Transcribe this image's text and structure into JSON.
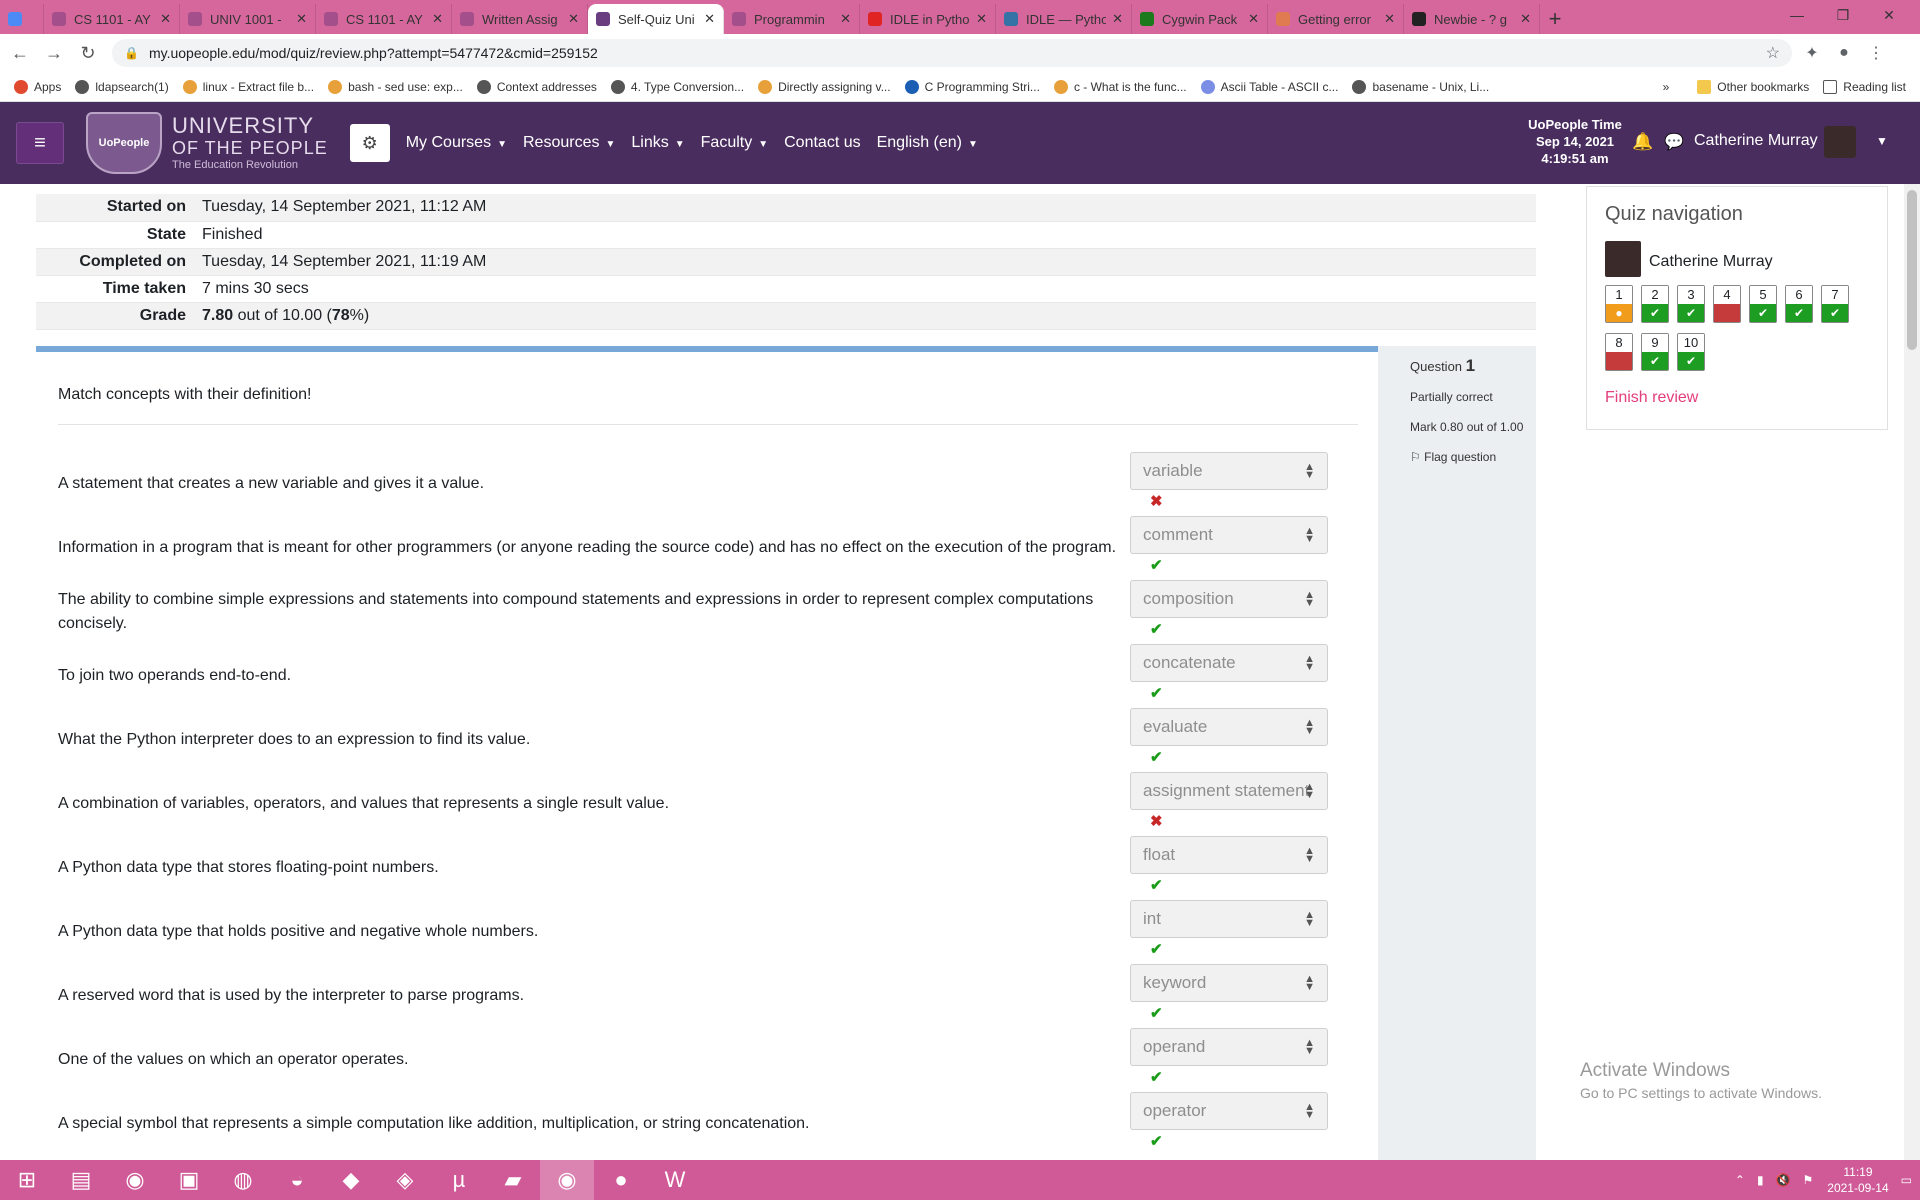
{
  "browser": {
    "tabs": [
      {
        "title": "",
        "color": "#4c8bf5"
      },
      {
        "title": "CS 1101 - AY",
        "color": "#a34f8c"
      },
      {
        "title": "UNIV 1001 -",
        "color": "#a34f8c"
      },
      {
        "title": "CS 1101 - AY",
        "color": "#a34f8c"
      },
      {
        "title": "Written Assig",
        "color": "#a34f8c"
      },
      {
        "title": "Self-Quiz Uni",
        "color": "#6a3d80",
        "active": true
      },
      {
        "title": "Programmin",
        "color": "#a34f8c"
      },
      {
        "title": "IDLE in Pytho",
        "color": "#e02424"
      },
      {
        "title": "IDLE — Pytho",
        "color": "#3572a5"
      },
      {
        "title": "Cygwin Pack",
        "color": "#1b7a1b"
      },
      {
        "title": "Getting error",
        "color": "#e07a50"
      },
      {
        "title": "Newbie - ? g",
        "color": "#222"
      }
    ],
    "url": "my.uopeople.edu/mod/quiz/review.php?attempt=5477472&cmid=259152",
    "bookmarks": [
      "Apps",
      "ldapsearch(1)",
      "linux - Extract file b...",
      "bash - sed use: exp...",
      "Context addresses",
      "4. Type Conversion...",
      "Directly assigning v...",
      "C Programming Stri...",
      "c - What is the func...",
      "Ascii Table - ASCII c...",
      "basename - Unix, Li..."
    ],
    "other_bookmarks": "Other bookmarks",
    "reading_list": "Reading list",
    "more": "»"
  },
  "header": {
    "logo": {
      "badge": "UoPeople",
      "line1": "UNIVERSITY",
      "line2": "OF THE PEOPLE",
      "tagline": "The Education Revolution"
    },
    "menu": [
      {
        "label": "My Courses",
        "caret": true
      },
      {
        "label": "Resources",
        "caret": true
      },
      {
        "label": "Links",
        "caret": true
      },
      {
        "label": "Faculty",
        "caret": true
      },
      {
        "label": "Contact us",
        "caret": false
      },
      {
        "label": "English (en)",
        "caret": true
      }
    ],
    "time_label": "UoPeople Time",
    "date": "Sep 14, 2021",
    "time": "4:19:51 am",
    "user_name": "Catherine Murray"
  },
  "summary": [
    {
      "label": "Started on",
      "value": "Tuesday, 14 September 2021, 11:12 AM"
    },
    {
      "label": "State",
      "value": "Finished"
    },
    {
      "label": "Completed on",
      "value": "Tuesday, 14 September 2021, 11:19 AM"
    },
    {
      "label": "Time taken",
      "value": "7 mins 30 secs"
    },
    {
      "label": "Grade",
      "value": "7.80",
      "rest": " out of 10.00 (",
      "pct": "78",
      "end": "%)"
    }
  ],
  "question": {
    "label": "Question",
    "number": "1",
    "state": "Partially correct",
    "mark": "Mark 0.80 out of 1.00",
    "flag": "Flag question",
    "prompt": "Match concepts with their definition!",
    "rows": [
      {
        "text": "A statement that creates a new variable and gives it a value.",
        "answer": "variable",
        "correct": false
      },
      {
        "text": "Information in a program that is meant for other programmers (or anyone reading the source code) and has no effect on the execution of the program.",
        "answer": "comment",
        "correct": true
      },
      {
        "text": "The ability to combine simple expressions and statements into compound statements and expressions in order to represent complex computations concisely.",
        "answer": "composition",
        "correct": true
      },
      {
        "text": "To join two operands end-to-end.",
        "answer": "concatenate",
        "correct": true
      },
      {
        "text": "What the Python interpreter does to an expression to find its value.",
        "answer": "evaluate",
        "correct": true
      },
      {
        "text": "A combination of variables, operators, and values that represents a single result value.",
        "answer": "assignment statement",
        "correct": false
      },
      {
        "text": "A Python data type that stores floating-point numbers.",
        "answer": "float",
        "correct": true
      },
      {
        "text": "A Python data type that holds positive and negative whole numbers.",
        "answer": "int",
        "correct": true
      },
      {
        "text": "A reserved word that is used by the interpreter to parse programs.",
        "answer": "keyword",
        "correct": true
      },
      {
        "text": "One of the values on which an operator operates.",
        "answer": "operand",
        "correct": true
      },
      {
        "text": "A special symbol that represents a simple computation like addition, multiplication, or string concatenation.",
        "answer": "operator",
        "correct": true
      }
    ]
  },
  "quiz_nav": {
    "title": "Quiz navigation",
    "user": "Catherine Murray",
    "questions": [
      {
        "n": "1",
        "status": "partial"
      },
      {
        "n": "2",
        "status": "correct"
      },
      {
        "n": "3",
        "status": "correct"
      },
      {
        "n": "4",
        "status": "incorrect"
      },
      {
        "n": "5",
        "status": "correct"
      },
      {
        "n": "6",
        "status": "correct"
      },
      {
        "n": "7",
        "status": "correct"
      },
      {
        "n": "8",
        "status": "incorrect"
      },
      {
        "n": "9",
        "status": "correct"
      },
      {
        "n": "10",
        "status": "correct"
      }
    ],
    "finish": "Finish review"
  },
  "watermark": {
    "title": "Activate Windows",
    "subtitle": "Go to PC settings to activate Windows."
  },
  "taskbar": {
    "apps": [
      "windows-start-icon",
      "file-explorer-icon",
      "chrome-icon",
      "store-icon",
      "globe-icon",
      "duck-icon",
      "vscode-icon",
      "visual-studio-icon",
      "utorrent-icon",
      "folder-icon",
      "chrome-profile-icon",
      "github-icon",
      "word-icon"
    ],
    "time": "11:19",
    "date": "2021-09-14"
  },
  "colors": {
    "header": "#4a2d5f",
    "accent": "#e33d7b",
    "correct": "#1d9e23",
    "incorrect": "#c53a3a",
    "partial": "#f29c1b",
    "tabstrip": "#d6679c"
  }
}
